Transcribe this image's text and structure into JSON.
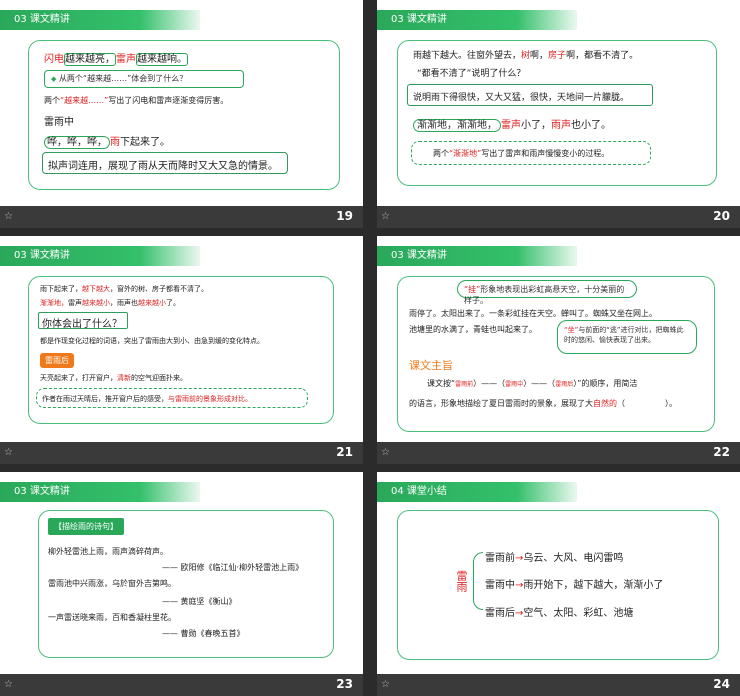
{
  "slides": [
    {
      "header": "03 课文精讲",
      "page": "19",
      "lines": {
        "l1_a": "闪电",
        "l1_b": "越来越亮，",
        "l1_c": "雷声",
        "l1_d": "越来越响。",
        "q": "从两个“越来越……”体会到了什么？",
        "l3_a": "两个",
        "l3_b": "“越来越……”",
        "l3_c": "写出了闪电和雷声逐渐变得厉害。",
        "l4": "雷雨中",
        "l5_a": "哗，哗，哗，",
        "l5_b": "雨",
        "l5_c": "下起来了。",
        "l6": "拟声词连用，展现了雨从天而降时又大又急的情景。"
      }
    },
    {
      "header": "03 课文精讲",
      "page": "20",
      "lines": {
        "l1_a": "雨越下越大。往窗外望去，",
        "l1_b": "树",
        "l1_c": "啊，",
        "l1_d": "房子",
        "l1_e": "啊，都看不清了。",
        "l2": "“都看不清了”说明了什么？",
        "l3": "说明雨下得很快，又大又猛，很快，天地间一片朦胧。",
        "l4_a": "渐渐地，渐渐地，",
        "l4_b": "雷声",
        "l4_c": "小了，",
        "l4_d": "雨声",
        "l4_e": "也小了。",
        "l5_a": "两个",
        "l5_b": "“渐渐地”",
        "l5_c": "写出了雷声和雨声慢慢变小的过程。"
      }
    },
    {
      "header": "03 课文精讲",
      "page": "21",
      "lines": {
        "l1_a": "雨下起来了，",
        "l1_b": "越下越大",
        "l1_c": "，窗外的树、房子都看不清了。",
        "l2_a": "渐渐地，",
        "l2_b": "雷声",
        "l2_c": "越来越小",
        "l2_d": "，雨声也",
        "l2_e": "越来越小",
        "l2_f": "了。",
        "q": "你体会出了什么？",
        "l4": "都是作现变化过程的词语，突出了雷雨由大到小、由急到缓的变化特点。",
        "tag": "雷雨后",
        "l6_a": "天亮起来了，打开窗户，",
        "l6_b": "清新",
        "l6_c": "的空气迎面扑来。",
        "l7_a": "作者在雨过天晴后，推开窗户后的感受，",
        "l7_b": "与雷雨前的景象形成对比。"
      }
    },
    {
      "header": "03 课文精讲",
      "page": "22",
      "lines": {
        "c1_a": "“挂”",
        "c1_b": "形象地表现出彩虹高悬天空，十分美丽的样子。",
        "l1": "雨停了。太阳出来了。一条彩虹挂在天空。蝉叫了。蜘蛛又坐在网上。",
        "l2": "池塘里的水满了，青蛙也叫起来了。",
        "c2_a": "“坐”",
        "c2_b": "与前面的“逃”进行对比，把蜘蛛此时的悠闲、愉快表现了出来。",
        "title": "课文主旨",
        "l3_a": "课文按“",
        "l3_b": "雷雨前",
        "l3_c": "）——（",
        "l3_d": "雷雨中",
        "l3_e": "）——（",
        "l3_f": "雷雨后",
        "l3_g": "）”的顺序，用简洁",
        "l4_a": "的语言，形象地描绘了夏日雷雨时的景象，展现了大",
        "l4_b": "自然的",
        "l4_c": "（",
        "l4_d": "）。"
      }
    },
    {
      "header": "03 课文精讲",
      "page": "23",
      "lines": {
        "tag": "【描绘雨的诗句】",
        "p1": "柳外轻雷池上雨，雨声滴碎荷声。",
        "p1s": "—— 欧阳修《临江仙·柳外轻雷池上雨》",
        "p2": "雷雨池中兴雨涨，乌於窗外吉第鸣。",
        "p2s": "—— 黄庭坚《衡山》",
        "p3": "一声雷送晓来雨，百和香凝柱里花。",
        "p3s": "—— 曹勋《春晚五首》"
      }
    },
    {
      "header": "04 课堂小结",
      "page": "24",
      "lines": {
        "center": "雷雨",
        "r1_a": "雷雨前",
        "r1_b": "乌云、大风、电闪雷鸣",
        "r2_a": "雷雨中",
        "r2_b": "雨开始下，越下越大，渐渐小了",
        "r3_a": "雷雨后",
        "r3_b": "空气、太阳、彩虹、池塘"
      }
    }
  ],
  "icons": {
    "star": "☆",
    "arrow": "→",
    "diamond": "◆"
  },
  "colors": {
    "accent": "#2aa85a",
    "red": "#e02020",
    "orange": "#f07a1a"
  }
}
